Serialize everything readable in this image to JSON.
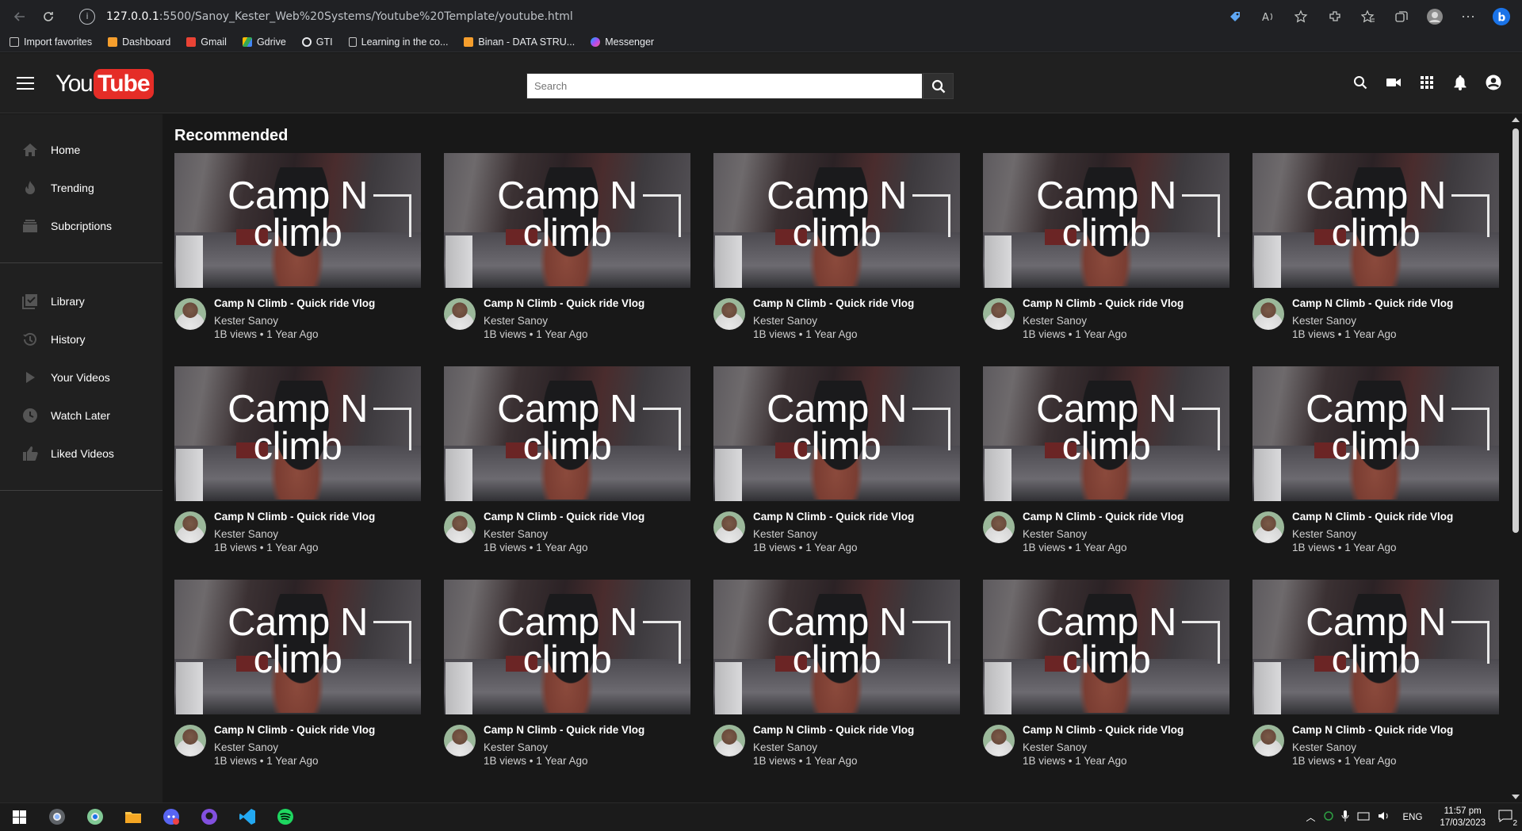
{
  "browser": {
    "url_host": "127.0.0.1",
    "url_path": ":5500/Sanoy_Kester_Web%20Systems/Youtube%20Template/youtube.html",
    "bookmarks": [
      {
        "label": "Import favorites",
        "color": "#c9c9c9"
      },
      {
        "label": "Dashboard",
        "color": "#f59e2d"
      },
      {
        "label": "Gmail",
        "color": "#ea4335"
      },
      {
        "label": "Gdrive",
        "color": "#34a853"
      },
      {
        "label": "GTI",
        "color": "#e8eaed"
      },
      {
        "label": "Learning in the co...",
        "color": "#c9c9c9"
      },
      {
        "label": "Binan - DATA STRU...",
        "color": "#f59e2d"
      },
      {
        "label": "Messenger",
        "color": "#a94cf5"
      }
    ]
  },
  "header": {
    "logo_you": "You",
    "logo_tube": "Tube",
    "search_placeholder": "Search"
  },
  "sidebar": {
    "primary": [
      {
        "label": "Home",
        "icon": "home-icon"
      },
      {
        "label": "Trending",
        "icon": "flame-icon"
      },
      {
        "label": "Subcriptions",
        "icon": "subscriptions-icon"
      }
    ],
    "secondary": [
      {
        "label": "Library",
        "icon": "library-icon"
      },
      {
        "label": "History",
        "icon": "history-icon"
      },
      {
        "label": "Your Videos",
        "icon": "play-icon"
      },
      {
        "label": "Watch Later",
        "icon": "clock-icon"
      },
      {
        "label": "Liked Videos",
        "icon": "thumbs-up-icon"
      }
    ]
  },
  "main": {
    "section_title": "Recommended",
    "video": {
      "thumb_line1": "Camp N",
      "thumb_line2": "climb",
      "title": "Camp N Climb - Quick ride Vlog",
      "channel": "Kester Sanoy",
      "stats": "1B views • 1 Year Ago"
    },
    "rows": 3,
    "cols": 5
  },
  "taskbar": {
    "lang": "ENG",
    "time": "11:57 pm",
    "date": "17/03/2023",
    "notifications": "2"
  }
}
